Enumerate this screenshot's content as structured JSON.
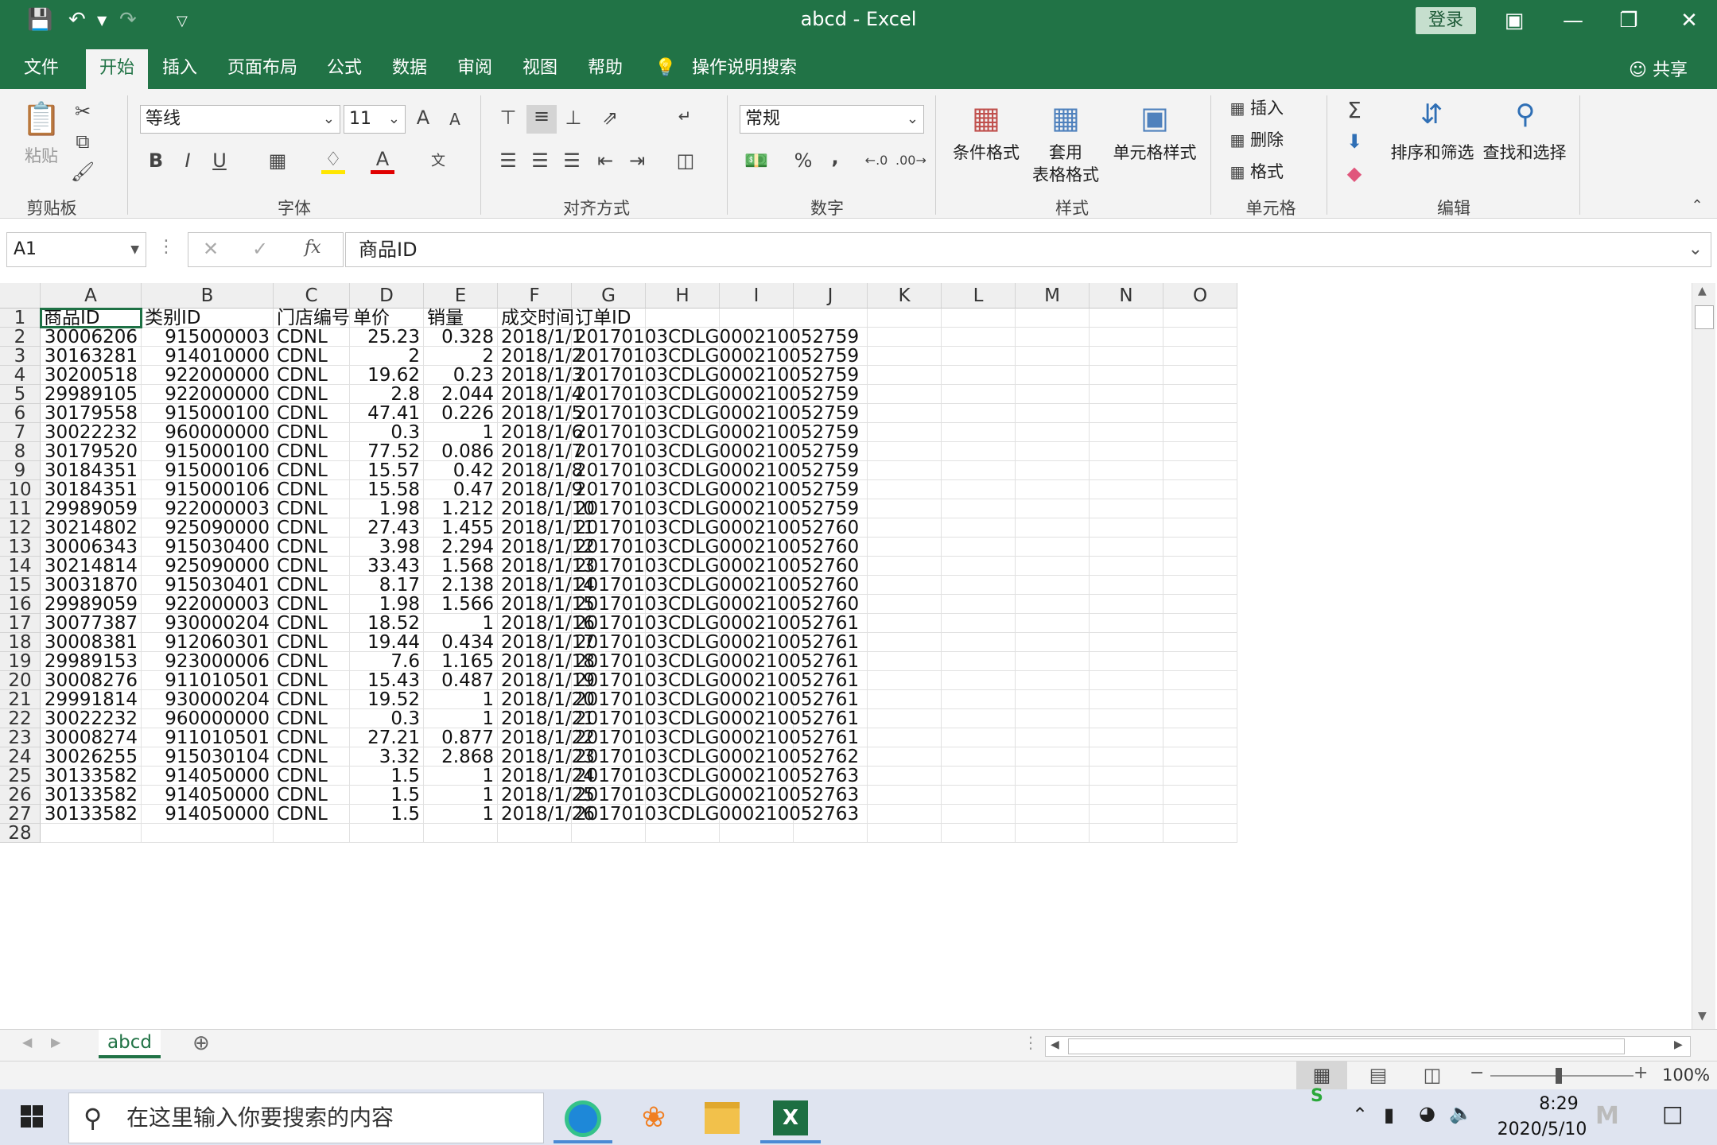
{
  "window": {
    "title": "abcd  -  Excel",
    "login_label": "登录"
  },
  "tabs": [
    {
      "label": "文件"
    },
    {
      "label": "开始"
    },
    {
      "label": "插入"
    },
    {
      "label": "页面布局"
    },
    {
      "label": "公式"
    },
    {
      "label": "数据"
    },
    {
      "label": "审阅"
    },
    {
      "label": "视图"
    },
    {
      "label": "帮助"
    },
    {
      "label": "操作说明搜索"
    }
  ],
  "share_label": "共享",
  "ribbon": {
    "clipboard": {
      "paste": "粘贴",
      "group": "剪贴板"
    },
    "font": {
      "name": "等线",
      "size": "11",
      "grow": "A",
      "shrink": "A",
      "bold": "B",
      "italic": "I",
      "underline": "U",
      "color_a": "A",
      "group": "字体"
    },
    "alignment": {
      "group": "对齐方式"
    },
    "number": {
      "format": "常规",
      "percent": "%",
      "comma": ",",
      "group": "数字"
    },
    "styles": {
      "cond": "条件格式",
      "table_l1": "套用",
      "table_l2": "表格格式",
      "cellstyle": "单元格样式",
      "group": "样式"
    },
    "cells": {
      "insert": "插入",
      "delete": "删除",
      "format": "格式",
      "group": "单元格"
    },
    "editing": {
      "sum": "Σ",
      "sort": "排序和筛选",
      "find": "查找和选择",
      "group": "编辑"
    }
  },
  "formula_bar": {
    "name_box": "A1",
    "fx": "fx",
    "value": "商品ID"
  },
  "columns": [
    "A",
    "B",
    "C",
    "D",
    "E",
    "F",
    "G",
    "H",
    "I",
    "J",
    "K",
    "L",
    "M",
    "N",
    "O"
  ],
  "headers": [
    "商品ID",
    "类别ID",
    "门店编号",
    "单价",
    "销量",
    "成交时间",
    "订单ID"
  ],
  "rows": [
    [
      "30006206",
      "915000003",
      "CDNL",
      "25.23",
      "0.328",
      "2018/1/1",
      "20170103CDLG000210052759"
    ],
    [
      "30163281",
      "914010000",
      "CDNL",
      "2",
      "2",
      "2018/1/2",
      "20170103CDLG000210052759"
    ],
    [
      "30200518",
      "922000000",
      "CDNL",
      "19.62",
      "0.23",
      "2018/1/3",
      "20170103CDLG000210052759"
    ],
    [
      "29989105",
      "922000000",
      "CDNL",
      "2.8",
      "2.044",
      "2018/1/4",
      "20170103CDLG000210052759"
    ],
    [
      "30179558",
      "915000100",
      "CDNL",
      "47.41",
      "0.226",
      "2018/1/5",
      "20170103CDLG000210052759"
    ],
    [
      "30022232",
      "960000000",
      "CDNL",
      "0.3",
      "1",
      "2018/1/6",
      "20170103CDLG000210052759"
    ],
    [
      "30179520",
      "915000100",
      "CDNL",
      "77.52",
      "0.086",
      "2018/1/7",
      "20170103CDLG000210052759"
    ],
    [
      "30184351",
      "915000106",
      "CDNL",
      "15.57",
      "0.42",
      "2018/1/8",
      "20170103CDLG000210052759"
    ],
    [
      "30184351",
      "915000106",
      "CDNL",
      "15.58",
      "0.47",
      "2018/1/9",
      "20170103CDLG000210052759"
    ],
    [
      "29989059",
      "922000003",
      "CDNL",
      "1.98",
      "1.212",
      "2018/1/10",
      "20170103CDLG000210052759"
    ],
    [
      "30214802",
      "925090000",
      "CDNL",
      "27.43",
      "1.455",
      "2018/1/11",
      "20170103CDLG000210052760"
    ],
    [
      "30006343",
      "915030400",
      "CDNL",
      "3.98",
      "2.294",
      "2018/1/12",
      "20170103CDLG000210052760"
    ],
    [
      "30214814",
      "925090000",
      "CDNL",
      "33.43",
      "1.568",
      "2018/1/13",
      "20170103CDLG000210052760"
    ],
    [
      "30031870",
      "915030401",
      "CDNL",
      "8.17",
      "2.138",
      "2018/1/14",
      "20170103CDLG000210052760"
    ],
    [
      "29989059",
      "922000003",
      "CDNL",
      "1.98",
      "1.566",
      "2018/1/15",
      "20170103CDLG000210052760"
    ],
    [
      "30077387",
      "930000204",
      "CDNL",
      "18.52",
      "1",
      "2018/1/16",
      "20170103CDLG000210052761"
    ],
    [
      "30008381",
      "912060301",
      "CDNL",
      "19.44",
      "0.434",
      "2018/1/17",
      "20170103CDLG000210052761"
    ],
    [
      "29989153",
      "923000006",
      "CDNL",
      "7.6",
      "1.165",
      "2018/1/18",
      "20170103CDLG000210052761"
    ],
    [
      "30008276",
      "911010501",
      "CDNL",
      "15.43",
      "0.487",
      "2018/1/19",
      "20170103CDLG000210052761"
    ],
    [
      "29991814",
      "930000204",
      "CDNL",
      "19.52",
      "1",
      "2018/1/20",
      "20170103CDLG000210052761"
    ],
    [
      "30022232",
      "960000000",
      "CDNL",
      "0.3",
      "1",
      "2018/1/21",
      "20170103CDLG000210052761"
    ],
    [
      "30008274",
      "911010501",
      "CDNL",
      "27.21",
      "0.877",
      "2018/1/22",
      "20170103CDLG000210052761"
    ],
    [
      "30026255",
      "915030104",
      "CDNL",
      "3.32",
      "2.868",
      "2018/1/23",
      "20170103CDLG000210052762"
    ],
    [
      "30133582",
      "914050000",
      "CDNL",
      "1.5",
      "1",
      "2018/1/24",
      "20170103CDLG000210052763"
    ],
    [
      "30133582",
      "914050000",
      "CDNL",
      "1.5",
      "1",
      "2018/1/25",
      "20170103CDLG000210052763"
    ],
    [
      "30133582",
      "914050000",
      "CDNL",
      "1.5",
      "1",
      "2018/1/26",
      "20170103CDLG000210052763"
    ]
  ],
  "sheet_tab": "abcd",
  "status": {
    "zoom": "100%"
  },
  "taskbar": {
    "search_placeholder": "在这里输入你要搜索的内容",
    "time": "8:29",
    "date": "2020/5/10"
  },
  "colors": {
    "excel_green": "#217346",
    "selection": "#1e7145",
    "taskbar": "#dfe4f0"
  }
}
